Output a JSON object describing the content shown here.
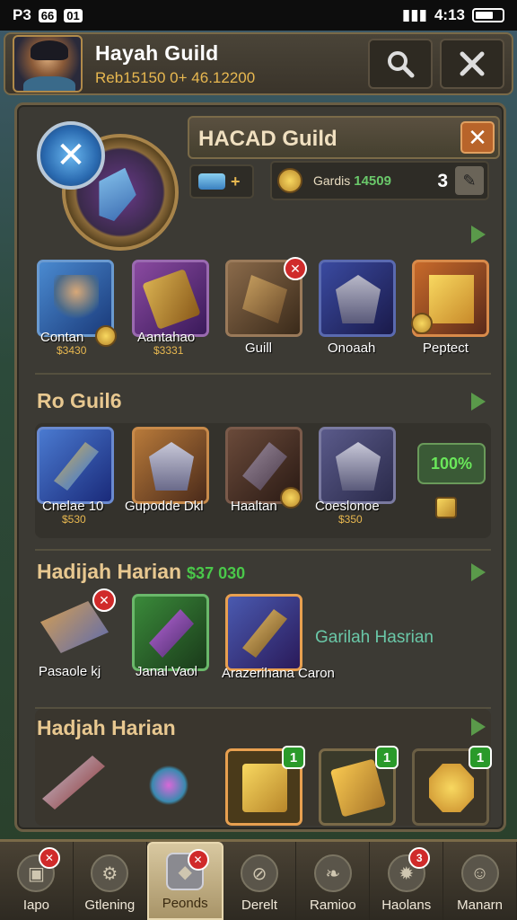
{
  "status_bar": {
    "left": "P3",
    "boxes": [
      "66",
      "01"
    ],
    "time": "4:13"
  },
  "header": {
    "title": "Hayah Guild",
    "subtitle": "Reb15150 0+ 46.12200",
    "search_icon": "search-icon",
    "close_icon": "close-icon"
  },
  "panel": {
    "title": "HACAD Guild",
    "close": "✕",
    "resource1_plus": "+",
    "resource2_label": "Gardis",
    "resource2_value": "14509",
    "resource2_count": "3",
    "resource2_edit": "✎"
  },
  "row1": [
    {
      "label": "Contan",
      "sub": "$3430",
      "color": "#3a6ab0",
      "badge": "coin"
    },
    {
      "label": "Aantahao",
      "sub": "$3331",
      "color": "#6a3a8a",
      "badge": ""
    },
    {
      "label": "Guill",
      "sub": "",
      "color": "#6a4a3a",
      "badge": "x"
    },
    {
      "label": "Onoaah",
      "sub": "",
      "color": "#2a3a7a",
      "badge": ""
    },
    {
      "label": "Peptect",
      "sub": "",
      "color": "#8a3a2a",
      "badge": "coin"
    }
  ],
  "section2": {
    "title": "Ro Guil6"
  },
  "row2": [
    {
      "label": "Cnelae 10",
      "sub": "$530",
      "color": "#2a4a9a"
    },
    {
      "label": "Gupodde Dkl",
      "sub": "",
      "color": "#8a5a2a"
    },
    {
      "label": "Haaltan",
      "sub": "",
      "color": "#4a3a2a"
    },
    {
      "label": "Coeslonoe",
      "sub": "$350",
      "color": "#4a4a6a"
    }
  ],
  "row2_pill": "100%",
  "section3": {
    "title": "Hadijah Harian",
    "money": "$37 030"
  },
  "row3": [
    {
      "label": "Pasaole kj",
      "color": "transparent",
      "badge": "x"
    },
    {
      "label": "Janal Vaol",
      "color": "#3a6a3a",
      "badge": ""
    },
    {
      "label": "Arazerihana Caron",
      "color": "#4a3a6a",
      "badge": ""
    }
  ],
  "row3_side": "Garilah Hasrian",
  "section4": {
    "title": "Hadjah Harian"
  },
  "row4": [
    {
      "badge": "",
      "color": "transparent"
    },
    {
      "badge": "",
      "color": "transparent"
    },
    {
      "badge": "1",
      "color": "#4a3a1a"
    },
    {
      "badge": "1",
      "color": "#3a3a2a"
    },
    {
      "badge": "1",
      "color": "#3a3428"
    }
  ],
  "nav": [
    {
      "label": "Iapo",
      "badge": "✕",
      "icon": "home-icon"
    },
    {
      "label": "Gtlening",
      "badge": "",
      "icon": "gear-icon"
    },
    {
      "label": "Peonds",
      "badge": "✕",
      "icon": "cube-icon"
    },
    {
      "label": "Derelt",
      "badge": "",
      "icon": "circle-icon"
    },
    {
      "label": "Ramioo",
      "badge": "",
      "icon": "leaf-icon"
    },
    {
      "label": "Haolans",
      "badge": "3",
      "icon": "cog-icon"
    },
    {
      "label": "Manarn",
      "badge": "",
      "icon": "face-icon"
    }
  ]
}
